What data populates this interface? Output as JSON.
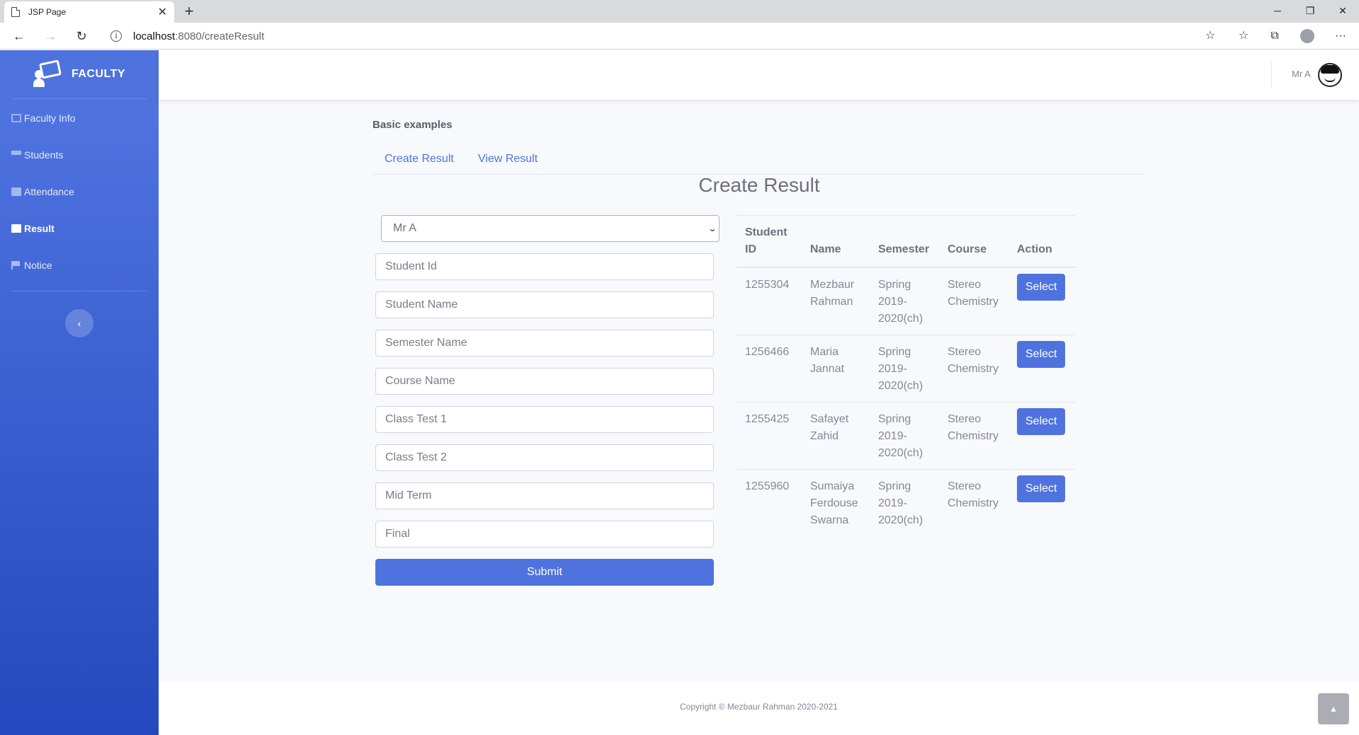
{
  "browser": {
    "tab_title": "JSP Page",
    "tab_close": "✕",
    "new_tab": "+",
    "url_host": "localhost",
    "url_path": ":8080/createResult",
    "back": "←",
    "forward": "→",
    "reload": "↻",
    "more": "···"
  },
  "sidebar": {
    "brand": "FACULTY",
    "items": [
      {
        "label": "Faculty Info",
        "icon": "id-card-icon"
      },
      {
        "label": "Students",
        "icon": "graduation-cap-icon"
      },
      {
        "label": "Attendance",
        "icon": "calendar-icon"
      },
      {
        "label": "Result",
        "icon": "calendar-icon",
        "active": true
      },
      {
        "label": "Notice",
        "icon": "flag-icon"
      }
    ],
    "toggle": "‹"
  },
  "topbar": {
    "user_name": "Mr A"
  },
  "main": {
    "section_title": "Basic examples",
    "tabs": [
      "Create Result",
      "View Result"
    ],
    "heading": "Create Result",
    "form": {
      "faculty_selected": "Mr A",
      "placeholders": {
        "student_id": "Student Id",
        "student_name": "Student Name",
        "semester_name": "Semester Name",
        "course_name": "Course Name",
        "class_test_1": "Class Test 1",
        "class_test_2": "Class Test 2",
        "mid_term": "Mid Term",
        "final": "Final"
      },
      "submit_label": "Submit"
    },
    "table": {
      "headers": [
        "Student ID",
        "Name",
        "Semester",
        "Course",
        "Action"
      ],
      "rows": [
        {
          "id": "1255304",
          "name": "Mezbaur Rahman",
          "semester": "Spring 2019-2020(ch)",
          "course": "Stereo Chemistry",
          "action": "Select"
        },
        {
          "id": "1256466",
          "name": "Maria Jannat",
          "semester": "Spring 2019-2020(ch)",
          "course": "Stereo Chemistry",
          "action": "Select"
        },
        {
          "id": "1255425",
          "name": "Safayet Zahid",
          "semester": "Spring 2019-2020(ch)",
          "course": "Stereo Chemistry",
          "action": "Select"
        },
        {
          "id": "1255960",
          "name": "Sumaiya Ferdouse Swarna",
          "semester": "Spring 2019-2020(ch)",
          "course": "Stereo Chemistry",
          "action": "Select"
        }
      ]
    }
  },
  "footer": {
    "copyright": "Copyright © Mezbaur Rahman 2020-2021"
  },
  "colors": {
    "primary": "#4e73df",
    "sidebar_gradient_end": "#224abe"
  }
}
